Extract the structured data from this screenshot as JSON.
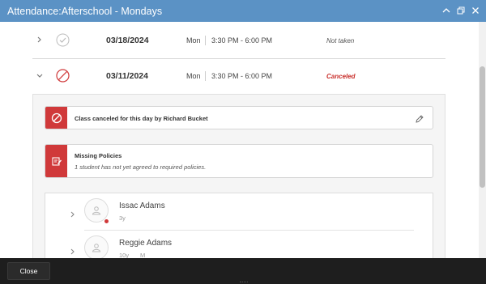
{
  "window": {
    "title": "Attendance:Afterschool - Mondays",
    "controls": [
      "collapse-icon",
      "restore-icon",
      "close-icon"
    ]
  },
  "days": [
    {
      "date": "03/18/2024",
      "day": "Mon",
      "time": "3:30 PM - 6:00 PM",
      "status": "Not taken",
      "expanded": false,
      "status_icon": "check-circle-icon"
    },
    {
      "date": "03/11/2024",
      "day": "Mon",
      "time": "3:30 PM - 6:00 PM",
      "status": "Canceled",
      "expanded": true,
      "status_icon": "cancel-circle-icon"
    }
  ],
  "alerts": {
    "canceled": {
      "text": "Class canceled for this day by Richard Bucket",
      "icon": "cancel-circle-icon"
    },
    "policies": {
      "title": "Missing Policies",
      "subtitle": "1 student has not yet agreed to required policies.",
      "icon": "policy-edit-icon"
    }
  },
  "students": [
    {
      "name": "Issac Adams",
      "age": "3y",
      "gender": "",
      "has_alert": true
    },
    {
      "name": "Reggie Adams",
      "age": "10y",
      "gender": "M",
      "has_alert": false
    }
  ],
  "footer": {
    "close_label": "Close"
  },
  "colors": {
    "titlebar": "#5b92c5",
    "alert_red": "#d0393a",
    "canceled_text": "#c9302c",
    "footer": "#1e1e1e"
  }
}
